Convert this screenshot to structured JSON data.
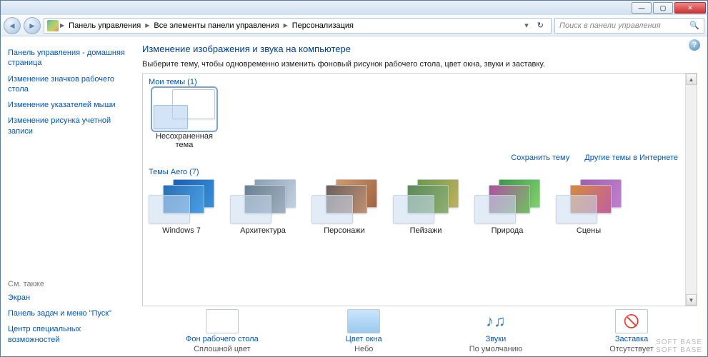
{
  "titlebar": {
    "min": "—",
    "max": "▢",
    "close": "✕"
  },
  "nav": {
    "back": "◄",
    "fwd": "►"
  },
  "breadcrumb": {
    "a": "Панель управления",
    "b": "Все элементы панели управления",
    "c": "Персонализация",
    "sep": "▶",
    "drop": "▾",
    "refresh": "↻"
  },
  "search": {
    "placeholder": "Поиск в панели управления"
  },
  "sidebar": {
    "links": [
      "Панель управления - домашняя страница",
      "Изменение значков рабочего стола",
      "Изменение указателей мыши",
      "Изменение рисунка учетной записи"
    ],
    "see_also_head": "См. также",
    "see_also": [
      "Экран",
      "Панель задач и меню \"Пуск\"",
      "Центр специальных возможностей"
    ]
  },
  "main": {
    "title": "Изменение изображения и звука на компьютере",
    "desc": "Выберите тему, чтобы одновременно изменить фоновый рисунок рабочего стола, цвет окна, звуки и заставку.",
    "help": "?",
    "my_themes_head": "Мои темы (1)",
    "my_theme_label": "Несохраненная тема",
    "save_link": "Сохранить тему",
    "more_link": "Другие темы в Интернете",
    "aero_head": "Темы Aero (7)",
    "aero_themes": [
      {
        "label": "Windows 7",
        "c1": "linear-gradient(120deg,#1a5fb4,#3a8fd4)",
        "c2": "linear-gradient(120deg,#2a6fb4,#4a9fe4)"
      },
      {
        "label": "Архитектура",
        "c1": "linear-gradient(120deg,#8aa0b4,#c0d0e0)",
        "c2": "linear-gradient(120deg,#6a8090,#a0b0c0)"
      },
      {
        "label": "Персонажи",
        "c1": "linear-gradient(120deg,#d49a6a,#a06644)",
        "c2": "linear-gradient(120deg,#6a6060,#c09070)"
      },
      {
        "label": "Пейзажи",
        "c1": "linear-gradient(120deg,#6a9a4a,#c0b060)",
        "c2": "linear-gradient(120deg,#5a8a5a,#90b070)"
      },
      {
        "label": "Природа",
        "c1": "linear-gradient(120deg,#3a9a4a,#80d070)",
        "c2": "linear-gradient(120deg,#b050a0,#70c060)"
      },
      {
        "label": "Сцены",
        "c1": "linear-gradient(120deg,#a060b0,#c080d0)",
        "c2": "linear-gradient(120deg,#d88a3a,#c060a0)"
      }
    ],
    "settings": [
      {
        "title": "Фон рабочего стола",
        "value": "Сплошной цвет"
      },
      {
        "title": "Цвет окна",
        "value": "Небо"
      },
      {
        "title": "Звуки",
        "value": "По умолчанию"
      },
      {
        "title": "Заставка",
        "value": "Отсутствует"
      }
    ]
  },
  "watermark": "SOFT   BASE"
}
